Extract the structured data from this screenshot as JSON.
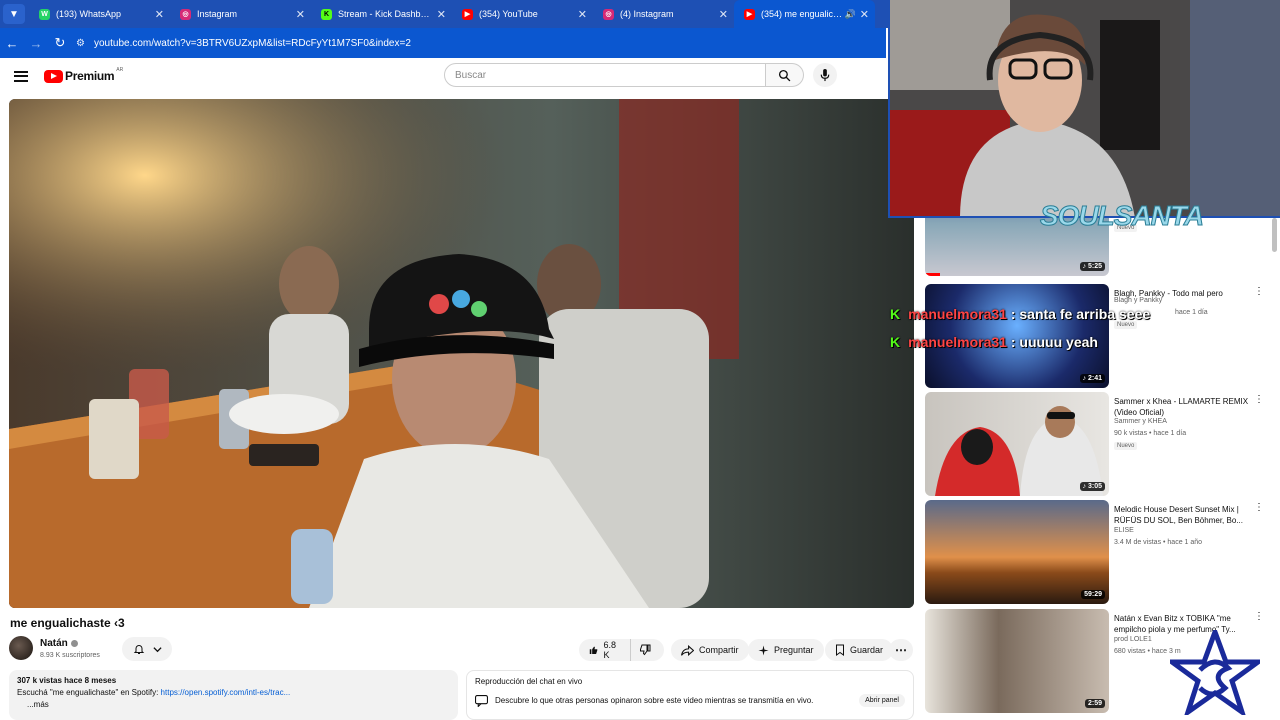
{
  "browser": {
    "tabs": [
      {
        "title": "(193) WhatsApp",
        "icon": "whatsapp-icon",
        "color": "#25d366"
      },
      {
        "title": "Instagram",
        "icon": "instagram-icon",
        "color": "#d62976"
      },
      {
        "title": "Stream - Kick Dashboard",
        "icon": "kick-icon",
        "color": "#53fc18"
      },
      {
        "title": "(354) YouTube",
        "icon": "youtube-icon",
        "color": "#ff0000"
      },
      {
        "title": "(4) Instagram",
        "icon": "instagram-icon",
        "color": "#d62976"
      },
      {
        "title": "(354) me engualichaste",
        "icon": "youtube-icon",
        "color": "#ff0000",
        "active": true
      }
    ],
    "url": "youtube.com/watch?v=3BTRV6UZxpM&list=RDcFyYt1M7SF0&index=2"
  },
  "header": {
    "logo_text": "Premium",
    "logo_sup": "AR",
    "search_placeholder": "Buscar"
  },
  "video": {
    "title": "me engualichaste ‹3",
    "channel": "Natán",
    "subscribers": "8.93 K suscriptores",
    "likes": "6.8 K",
    "share": "Compartir",
    "ask": "Preguntar",
    "save": "Guardar"
  },
  "description": {
    "meta": "307 k vistas  hace 8 meses",
    "line_prefix": "Escuchá \"me engualichaste\" en Spotify: ",
    "link": "https://open.spotify.com/intl-es/trac...",
    "more": "...más"
  },
  "live_chat": {
    "title": "Reproducción del chat en vivo",
    "text": "Descubre lo que otras personas opinaron sobre este video mientras se transmitía en vivo.",
    "button": "Abrir panel"
  },
  "recommendations": [
    {
      "title": "",
      "channel": "",
      "stats": "",
      "badge": "Nuevo",
      "duration": "5:25",
      "thumb": "#6a8a9a",
      "progress": 0.08
    },
    {
      "title": "Blagh, Pankky - Todo mal pero",
      "channel": "Blagh  y Pankky",
      "stats": "hace 1 día",
      "badge": "Nuevo",
      "duration": "2:41",
      "thumb": "#1b2a6a"
    },
    {
      "title": "Sammer x Khea - LLAMARTE REMIX (Video Oficial)",
      "channel": "Sammer  y KHEA",
      "stats": "90 k vistas • hace 1 día",
      "badge": "Nuevo",
      "duration": "3:05",
      "thumb": "#d8d4cf"
    },
    {
      "title": "Melodic House Desert Sunset Mix | RÜFÜS DU SOL, Ben Böhmer,  Bo...",
      "channel": "ELISE",
      "stats": "3.4 M de vistas • hace 1 año",
      "badge": "",
      "duration": "59:29",
      "thumb": "#c26a24"
    },
    {
      "title": "Natán x Evan Bitz x TOBIKA \"me empilcho piola y me perfumo\" Ty...",
      "channel": "prod LOLE1",
      "stats": "680 vistas • hace 3 m",
      "badge": "",
      "duration": "2:59",
      "thumb": "#7a6a5c"
    }
  ],
  "stream_overlay": {
    "brand": "SOULSANTA",
    "chat": [
      {
        "user": "manuelmora31",
        "message": ": santa fe arriba seee"
      },
      {
        "user": "manuelmora31",
        "message": ": uuuuu yeah"
      }
    ]
  }
}
